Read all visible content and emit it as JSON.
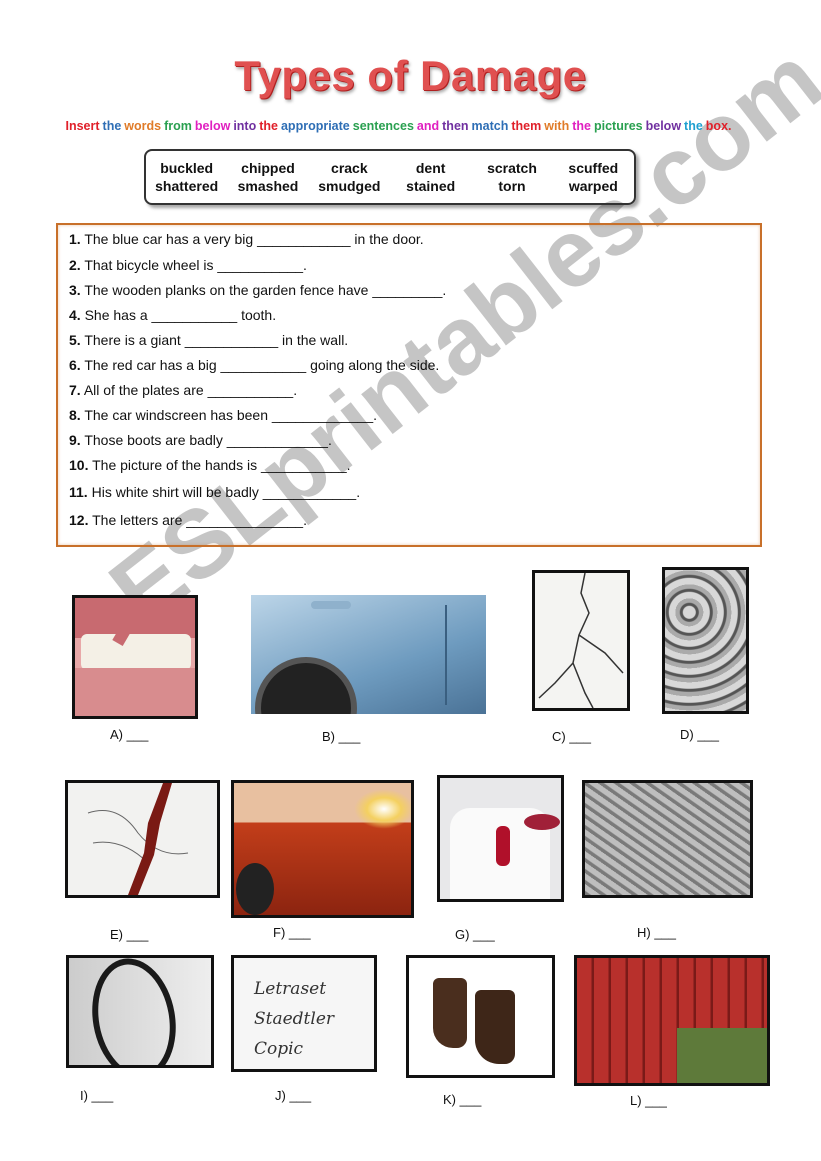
{
  "title": "Types of Damage",
  "instruction": [
    {
      "w": "Insert",
      "c": "#e0202a"
    },
    {
      "w": "the",
      "c": "#2e6eb5"
    },
    {
      "w": "words",
      "c": "#e07b28"
    },
    {
      "w": "from",
      "c": "#2aa050"
    },
    {
      "w": "below",
      "c": "#e020c0"
    },
    {
      "w": "into",
      "c": "#7030a0"
    },
    {
      "w": "the",
      "c": "#e0202a"
    },
    {
      "w": "appropriate",
      "c": "#2e6eb5"
    },
    {
      "w": "sentences",
      "c": "#2aa050"
    },
    {
      "w": "and",
      "c": "#e020c0"
    },
    {
      "w": "then",
      "c": "#7030a0"
    },
    {
      "w": "match",
      "c": "#2e6eb5"
    },
    {
      "w": "them",
      "c": "#e0202a"
    },
    {
      "w": "with",
      "c": "#e07b28"
    },
    {
      "w": "the",
      "c": "#e020c0"
    },
    {
      "w": "pictures",
      "c": "#2aa050"
    },
    {
      "w": "below",
      "c": "#7030a0"
    },
    {
      "w": "the",
      "c": "#20a0d0"
    },
    {
      "w": "box.",
      "c": "#e0202a"
    }
  ],
  "word_box": [
    "buckled",
    "chipped",
    "crack",
    "dent",
    "scratch",
    "scuffed",
    "shattered",
    "smashed",
    "smudged",
    "stained",
    "torn",
    "warped"
  ],
  "sentences": [
    {
      "n": "1.",
      "before": "The blue car has a very big",
      "blank": "____________",
      "after": "in the door."
    },
    {
      "n": "2.",
      "before": "That bicycle wheel is",
      "blank": "___________",
      "after": "."
    },
    {
      "n": "3.",
      "before": "The wooden planks on the garden fence have",
      "blank": "_________",
      "after": "."
    },
    {
      "n": "4.",
      "before": "She has a",
      "blank": "___________",
      "after": "tooth."
    },
    {
      "n": "5.",
      "before": "There is a giant",
      "blank": "____________",
      "after": "in the wall."
    },
    {
      "n": "6.",
      "before": "The red car has a big",
      "blank": "___________",
      "after": "going along the side."
    },
    {
      "n": "7.",
      "before": "All of the plates are",
      "blank": "___________",
      "after": "."
    },
    {
      "n": "8.",
      "before": "The car windscreen has been",
      "blank": "_____________",
      "after": "."
    },
    {
      "n": "9.",
      "before": "Those boots are badly",
      "blank": "_____________",
      "after": "."
    },
    {
      "n": "10.",
      "before": "The picture of the hands is",
      "blank": "___________",
      "after": "."
    },
    {
      "n": "11.",
      "before": "His white shirt will be badly",
      "blank": "____________",
      "after": "."
    },
    {
      "n": "12.",
      "before": "The letters are",
      "blank": "_______________",
      "after": "."
    }
  ],
  "pictures": [
    {
      "label": "A) ___",
      "subject": "chipped tooth"
    },
    {
      "label": "B) ___",
      "subject": "dented blue car door"
    },
    {
      "label": "C) ___",
      "subject": "cracked wall"
    },
    {
      "label": "D) ___",
      "subject": "smashed plates"
    },
    {
      "label": "E) ___",
      "subject": "torn drawing of hands"
    },
    {
      "label": "F) ___",
      "subject": "scratched red car"
    },
    {
      "label": "G) ___",
      "subject": "stained white shirt"
    },
    {
      "label": "H) ___",
      "subject": "shattered windscreen"
    },
    {
      "label": "I) ___",
      "subject": "buckled bicycle wheel"
    },
    {
      "label": "J) ___",
      "subject": "smudged letters",
      "text": [
        "Letraset",
        "Staedtler",
        "Copic"
      ]
    },
    {
      "label": "K) ___",
      "subject": "scuffed boots"
    },
    {
      "label": "L) ___",
      "subject": "warped fence"
    }
  ],
  "watermark": "ESLprintables.com"
}
